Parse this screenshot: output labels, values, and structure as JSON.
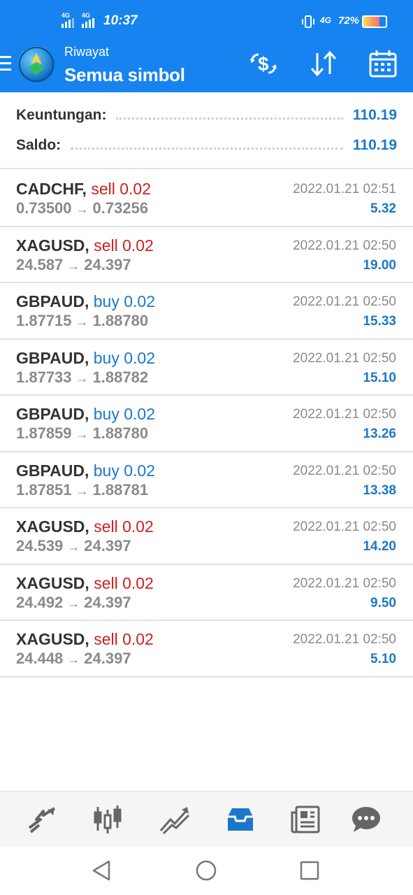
{
  "status_bar": {
    "sim1_label": "4G",
    "sim2_label": "4G",
    "time": "10:37",
    "network_label": "4G",
    "battery_percent": "72%",
    "battery_level": 0.72
  },
  "app_bar": {
    "subtitle": "Riwayat",
    "title": "Semua simbol",
    "icons": [
      "menu-icon",
      "metatrader-logo",
      "currency-exchange-icon",
      "sort-icon",
      "calendar-icon"
    ]
  },
  "summary": {
    "profit_label": "Keuntungan:",
    "profit_value": "110.19",
    "balance_label": "Saldo:",
    "balance_value": "110.19"
  },
  "trades": [
    {
      "symbol": "CADCHF,",
      "side": "sell",
      "volume": "sell 0.02",
      "open": "0.73500",
      "close": "0.73256",
      "time": "2022.01.21 02:51",
      "profit": "5.32"
    },
    {
      "symbol": "XAGUSD,",
      "side": "sell",
      "volume": "sell 0.02",
      "open": "24.587",
      "close": "24.397",
      "time": "2022.01.21 02:50",
      "profit": "19.00"
    },
    {
      "symbol": "GBPAUD,",
      "side": "buy",
      "volume": "buy 0.02",
      "open": "1.87715",
      "close": "1.88780",
      "time": "2022.01.21 02:50",
      "profit": "15.33"
    },
    {
      "symbol": "GBPAUD,",
      "side": "buy",
      "volume": "buy 0.02",
      "open": "1.87733",
      "close": "1.88782",
      "time": "2022.01.21 02:50",
      "profit": "15.10"
    },
    {
      "symbol": "GBPAUD,",
      "side": "buy",
      "volume": "buy 0.02",
      "open": "1.87859",
      "close": "1.88780",
      "time": "2022.01.21 02:50",
      "profit": "13.26"
    },
    {
      "symbol": "GBPAUD,",
      "side": "buy",
      "volume": "buy 0.02",
      "open": "1.87851",
      "close": "1.88781",
      "time": "2022.01.21 02:50",
      "profit": "13.38"
    },
    {
      "symbol": "XAGUSD,",
      "side": "sell",
      "volume": "sell 0.02",
      "open": "24.539",
      "close": "24.397",
      "time": "2022.01.21 02:50",
      "profit": "14.20"
    },
    {
      "symbol": "XAGUSD,",
      "side": "sell",
      "volume": "sell 0.02",
      "open": "24.492",
      "close": "24.397",
      "time": "2022.01.21 02:50",
      "profit": "9.50"
    },
    {
      "symbol": "XAGUSD,",
      "side": "sell",
      "volume": "sell 0.02",
      "open": "24.448",
      "close": "24.397",
      "time": "2022.01.21 02:50",
      "profit": "5.10"
    }
  ],
  "arrow_glyph": "→",
  "bottom_nav": {
    "items": [
      "quotes-icon",
      "chart-icon",
      "trade-icon",
      "history-icon",
      "news-icon",
      "chat-icon"
    ],
    "active": "history-icon"
  },
  "system_nav": [
    "back-icon",
    "home-icon",
    "recents-icon"
  ],
  "colors": {
    "brand": "#1683f0",
    "sell": "#cf1f1f",
    "buy": "#1b78c8",
    "profit": "#1b78c8",
    "muted": "#8a8a8a"
  }
}
